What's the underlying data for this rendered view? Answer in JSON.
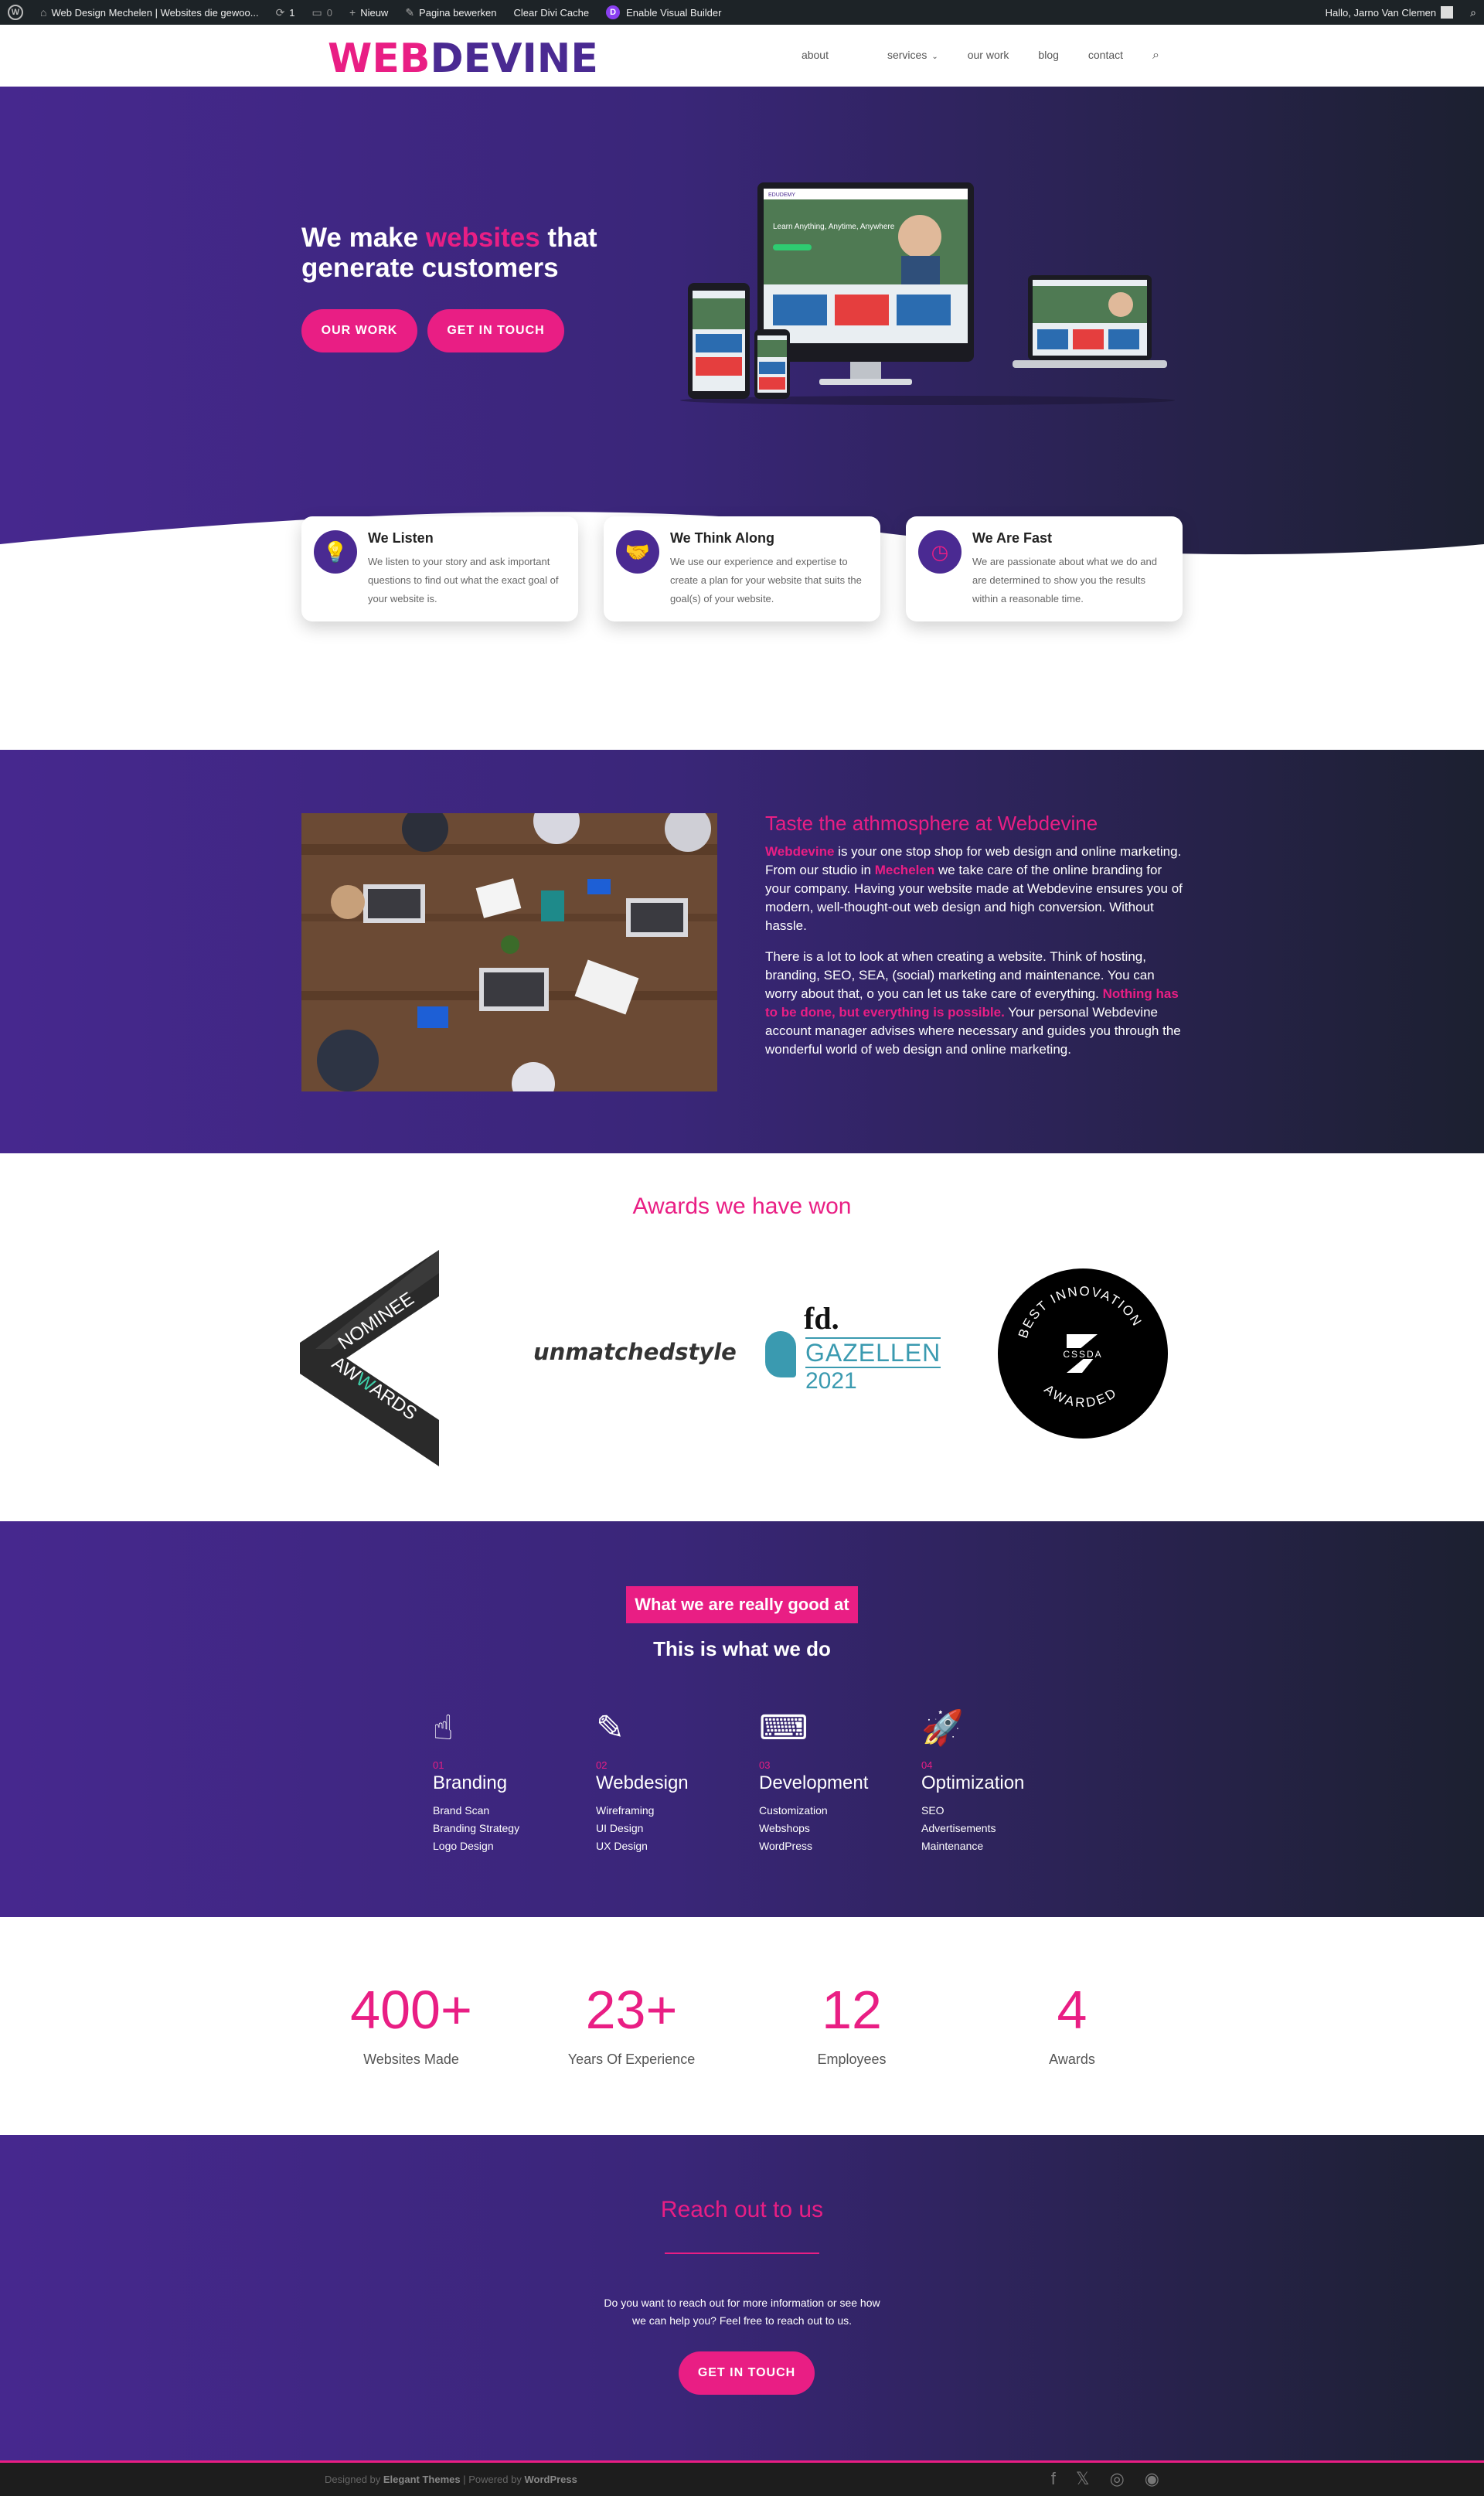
{
  "admin_bar": {
    "site_title": "Web Design Mechelen | Websites die gewoo...",
    "updates_count": "1",
    "comments_count": "0",
    "new_label": "Nieuw",
    "edit_page": "Pagina bewerken",
    "clear_cache": "Clear Divi Cache",
    "visual_builder": "Enable Visual Builder",
    "greeting": "Hallo, Jarno Van Clemen"
  },
  "header": {
    "logo_part1": "WEB",
    "logo_part2": "DEVINE",
    "nav": [
      "about",
      "services",
      "our work",
      "blog",
      "contact"
    ]
  },
  "hero": {
    "title_pre": "We make ",
    "title_highlight": "websites",
    "title_post": " that generate customers",
    "btn_work": "OUR WORK",
    "btn_touch": "GET IN TOUCH",
    "mockup_tagline": "Learn Anything, Anytime, Anywhere",
    "mockup_logo": "EDUDEMY"
  },
  "features": [
    {
      "title": "We Listen",
      "text": "We listen to your story and ask important questions to find out what the exact goal of your website is.",
      "icon": "lightbulb-icon"
    },
    {
      "title": "We Think Along",
      "text": "We use our experience and expertise to create a plan for your website that suits the goal(s) of your website.",
      "icon": "handshake-icon"
    },
    {
      "title": "We Are Fast",
      "text": "We are passionate about what we do and are determined to show you the results within a reasonable time.",
      "icon": "clock-icon"
    }
  ],
  "atmosphere": {
    "heading": "Taste the athmosphere at Webdevine",
    "p1_brand": "Webdevine",
    "p1_a": " is your one stop shop for web  design and online marketing. From our studio in ",
    "p1_city": "Mechelen",
    "p1_b": " we take care of the online branding for your company. Having your website made at Webdevine ensures you of modern, well-thought-out web design and high conversion. Without hassle.",
    "p2_a": "There is a lot to look at when creating a website. Think of hosting, branding, SEO, SEA, (social) marketing and maintenance. You can worry about that, o you can let us take care of everything. ",
    "p2_highlight": "Nothing has to be done, but everything is possible.",
    "p2_b": " Your personal Webdevine account manager advises where necessary and guides you through the wonderful world of web design and online marketing."
  },
  "awards": {
    "heading": "Awards we have won",
    "awwwards_top": "NOMINEE",
    "awwwards_bottom_a": "AW",
    "awwwards_bottom_b": "W",
    "awwwards_bottom_c": "ARDS",
    "unmatched": "unmatchedstyle",
    "fd": "fd.",
    "gazellen": "GAZELLEN",
    "gazellen_year": "2021",
    "cssda_top": "BEST INNOVATION",
    "cssda_mid": "CSSDA",
    "cssda_bottom": "AWARDED"
  },
  "services": {
    "tag": "What we are really good at",
    "heading": "This is what we do",
    "items": [
      {
        "num": "01",
        "title": "Branding",
        "list": [
          "Brand Scan",
          "Branding Strategy",
          "Logo Design"
        ],
        "icon": "fingerprint-icon",
        "glyph": "☝"
      },
      {
        "num": "02",
        "title": "Webdesign",
        "list": [
          "Wireframing",
          "UI Design",
          "UX Design"
        ],
        "icon": "pencil-ruler-icon",
        "glyph": "✎"
      },
      {
        "num": "03",
        "title": "Development",
        "list": [
          "Customization",
          "Webshops",
          "WordPress"
        ],
        "icon": "keyboard-icon",
        "glyph": "⌨"
      },
      {
        "num": "04",
        "title": "Optimization",
        "list": [
          "SEO",
          "Advertisements",
          "Maintenance"
        ],
        "icon": "rocket-icon",
        "glyph": "🚀"
      }
    ]
  },
  "stats": [
    {
      "value": "400+",
      "label": "Websites Made"
    },
    {
      "value": "23+",
      "label": "Years Of Experience"
    },
    {
      "value": "12",
      "label": "Employees"
    },
    {
      "value": "4",
      "label": "Awards"
    }
  ],
  "reach": {
    "heading": "Reach out to us",
    "line1": "Do you want to reach out for more information or see how",
    "line2": "we can help you? Feel free to reach out to us.",
    "btn": "GET IN TOUCH"
  },
  "footer": {
    "designed_by": "Designed by ",
    "elegant": "Elegant Themes",
    "sep": " | Powered by ",
    "wordpress": "WordPress"
  },
  "colors": {
    "accent": "#e91e84",
    "purple": "#4a2a92",
    "dark": "#1c2030"
  }
}
